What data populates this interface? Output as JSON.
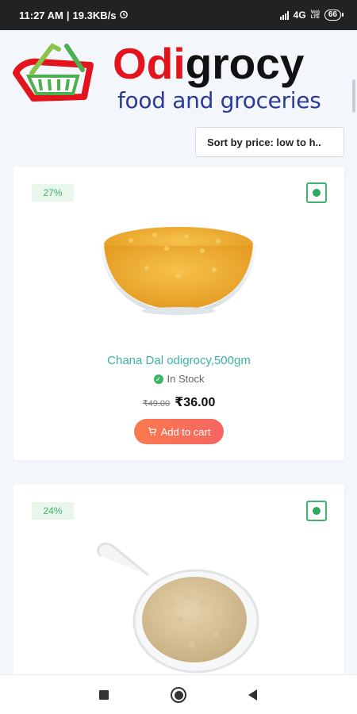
{
  "status_bar": {
    "time": "11:27 AM",
    "speed": "19.3KB/s",
    "network": "4G",
    "volte_line1": "Vo))",
    "volte_line2": "LTE",
    "battery": "66"
  },
  "header": {
    "brand_red": "Odi",
    "brand_black": "grocy",
    "tagline": "food and groceries",
    "colors": {
      "brand_red": "#e3141b",
      "tagline_blue": "#2a3b9b"
    }
  },
  "sort": {
    "selected": "Sort by price: low to h.."
  },
  "products": [
    {
      "discount": "27%",
      "name": "Chana Dal odigrocy,500gm",
      "stock": "In Stock",
      "old_price": "₹49.00",
      "new_price": "₹36.00",
      "cart_label": "Add to cart",
      "image": "chana-dal-bowl"
    },
    {
      "discount": "24%",
      "image": "white-beans-spoon"
    }
  ],
  "nav": {
    "icons": [
      "recent-apps-icon",
      "home-icon",
      "back-icon"
    ]
  }
}
